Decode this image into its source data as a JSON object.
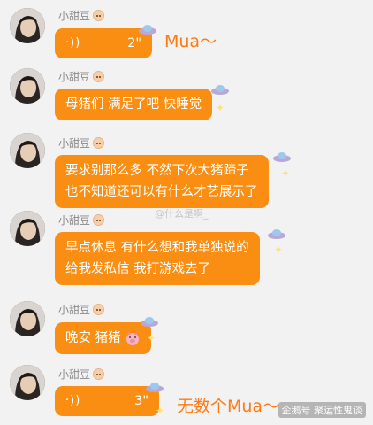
{
  "messages": [
    {
      "sender": "小甜豆",
      "type": "voice",
      "duration": "2\"",
      "annotation": "Mua～"
    },
    {
      "sender": "小甜豆",
      "type": "text",
      "lines": [
        "母猪们 满足了吧 快睡觉"
      ]
    },
    {
      "sender": "小甜豆",
      "type": "text",
      "lines": [
        "要求别那么多 不然下次大猪蹄子",
        "也不知道还可以有什么才艺展示了"
      ]
    },
    {
      "sender": "小甜豆",
      "type": "text",
      "lines": [
        "早点休息 有什么想和我单独说的",
        "给我发私信 我打游戏去了"
      ]
    },
    {
      "sender": "小甜豆",
      "type": "text",
      "lines": [
        "晚安 猪猪"
      ]
    },
    {
      "sender": "小甜豆",
      "type": "voice",
      "duration": "3\"",
      "annotation": "无数个Mua～"
    }
  ],
  "icons": {
    "voice": "sound-wave-icon",
    "ufo": "ufo-sticker-icon",
    "sparkle": "sparkle-icon",
    "pig": "pig-face-icon",
    "baby": "baby-face-icon"
  },
  "watermarks": {
    "center": "@什么是啊_",
    "bottom": "企鹅号 聚运性鬼谈"
  },
  "colors": {
    "bubble": "#f98e12",
    "annotation": "#ff7a12",
    "background": "#f2f2f2"
  }
}
